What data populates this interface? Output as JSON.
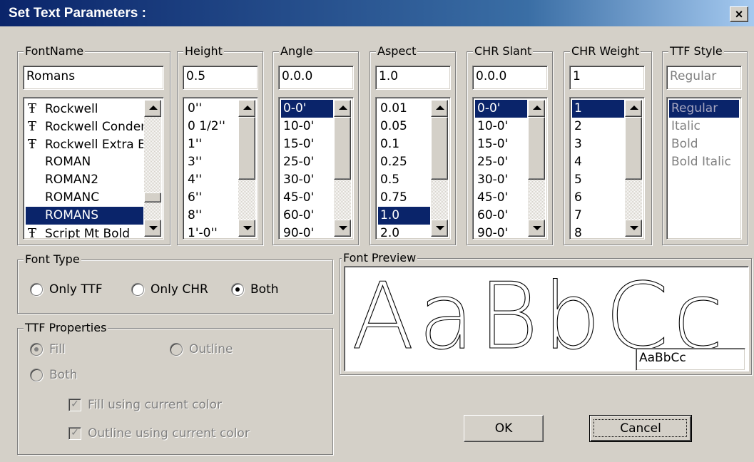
{
  "window": {
    "title": "Set Text Parameters :",
    "close_label": "×"
  },
  "fontname": {
    "legend": "FontName",
    "value": "Romans",
    "items": [
      {
        "label": "Rockwell",
        "ttf": true,
        "selected": false
      },
      {
        "label": "Rockwell Condensed",
        "ttf": true,
        "selected": false
      },
      {
        "label": "Rockwell Extra Bold",
        "ttf": true,
        "selected": false
      },
      {
        "label": "ROMAN",
        "ttf": false,
        "selected": false
      },
      {
        "label": "ROMAN2",
        "ttf": false,
        "selected": false
      },
      {
        "label": "ROMANC",
        "ttf": false,
        "selected": false
      },
      {
        "label": "ROMANS",
        "ttf": false,
        "selected": true
      },
      {
        "label": "Script Mt Bold",
        "ttf": true,
        "selected": false
      }
    ]
  },
  "height": {
    "legend": "Height",
    "value": "0.5",
    "items": [
      "0''",
      "0 1/2''",
      "1''",
      "3''",
      "4''",
      "6''",
      "8''",
      "1'-0''"
    ],
    "selected": -1
  },
  "angle": {
    "legend": "Angle",
    "value": "0.0.0",
    "items": [
      "0-0'",
      "10-0'",
      "15-0'",
      "25-0'",
      "30-0'",
      "45-0'",
      "60-0'",
      "90-0'"
    ],
    "selected": 0
  },
  "aspect": {
    "legend": "Aspect",
    "value": "1.0",
    "items": [
      "0.01",
      "0.05",
      "0.1",
      "0.25",
      "0.5",
      "0.75",
      "1.0",
      "2.0"
    ],
    "selected": 6
  },
  "slant": {
    "legend": "CHR Slant",
    "value": "0.0.0",
    "items": [
      "0-0'",
      "10-0'",
      "15-0'",
      "25-0'",
      "30-0'",
      "45-0'",
      "60-0'",
      "90-0'"
    ],
    "selected": 0
  },
  "weight": {
    "legend": "CHR Weight",
    "value": "1",
    "items": [
      "1",
      "2",
      "3",
      "4",
      "5",
      "6",
      "7",
      "8"
    ],
    "selected": 0
  },
  "ttf_style": {
    "legend": "TTF Style",
    "value": "Regular",
    "items": [
      "Regular",
      "Italic",
      "Bold",
      "Bold Italic"
    ],
    "selected": 0
  },
  "font_type": {
    "legend": "Font Type",
    "options": [
      {
        "label": "Only TTF",
        "checked": false
      },
      {
        "label": "Only CHR",
        "checked": false
      },
      {
        "label": "Both",
        "checked": true
      }
    ]
  },
  "ttf_properties": {
    "legend": "TTF Properties",
    "fill_label": "Fill",
    "outline_label": "Outline",
    "both_label": "Both",
    "fill_color_label": "Fill using current color",
    "outline_color_label": "Outline using current color"
  },
  "preview": {
    "legend": "Font Preview",
    "text": "AaBbCc",
    "input_value": "AaBbCc"
  },
  "buttons": {
    "ok": "OK",
    "cancel": "Cancel"
  }
}
